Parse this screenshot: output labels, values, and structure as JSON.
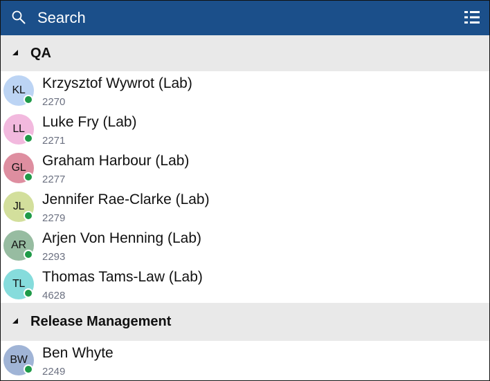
{
  "header": {
    "search_label": "Search",
    "search_icon": "search-icon",
    "view_icon": "list-view-icon",
    "background": "#1b4f8a"
  },
  "sections": [
    {
      "title": "QA",
      "expanded": true,
      "contacts": [
        {
          "initials": "KL",
          "name": "Krzysztof Wywrot (Lab)",
          "extension": "2270",
          "avatar_color": "#bcd4f4",
          "status": "online"
        },
        {
          "initials": "LL",
          "name": "Luke Fry (Lab)",
          "extension": "2271",
          "avatar_color": "#f2b9de",
          "status": "online"
        },
        {
          "initials": "GL",
          "name": "Graham Harbour (Lab)",
          "extension": "2277",
          "avatar_color": "#de8ea0",
          "status": "online"
        },
        {
          "initials": "JL",
          "name": "Jennifer Rae-Clarke (Lab)",
          "extension": "2279",
          "avatar_color": "#d3df9c",
          "status": "online"
        },
        {
          "initials": "AR",
          "name": "Arjen Von Henning (Lab)",
          "extension": "2293",
          "avatar_color": "#97bca1",
          "status": "online"
        },
        {
          "initials": "TL",
          "name": "Thomas Tams-Law (Lab)",
          "extension": "4628",
          "avatar_color": "#86dcdc",
          "status": "online"
        }
      ]
    },
    {
      "title": "Release Management",
      "expanded": true,
      "contacts": [
        {
          "initials": "BW",
          "name": "Ben Whyte",
          "extension": "2249",
          "avatar_color": "#a0b4d6",
          "status": "online"
        }
      ]
    }
  ],
  "colors": {
    "section_bg": "#e9e9e9",
    "presence_online": "#1f9a48",
    "extension_text": "#6b7080"
  }
}
